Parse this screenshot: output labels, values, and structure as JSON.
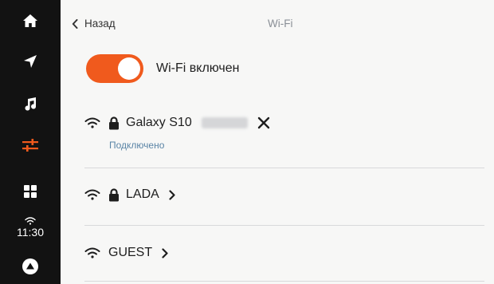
{
  "clock": {
    "time": "11:30"
  },
  "header": {
    "back_label": "Назад",
    "title": "Wi-Fi"
  },
  "wifi_toggle": {
    "label": "Wi-Fi включен",
    "on": true,
    "accent_color": "#f05a1d"
  },
  "networks": [
    {
      "name": "Galaxy S10",
      "secured": true,
      "status": "Подключено",
      "action": "close-icon"
    },
    {
      "name": "LADA",
      "secured": true,
      "action": "chevron-right-icon"
    },
    {
      "name": "GUEST",
      "secured": false,
      "action": "chevron-right-icon"
    }
  ],
  "sidebar": {
    "items": [
      {
        "icon": "home-icon"
      },
      {
        "icon": "navigation-arrow-icon"
      },
      {
        "icon": "music-note-icon"
      },
      {
        "icon": "settings-sliders-icon",
        "active": true
      },
      {
        "icon": "apps-grid-icon"
      },
      {
        "icon": "alice-assistant-icon"
      }
    ]
  }
}
